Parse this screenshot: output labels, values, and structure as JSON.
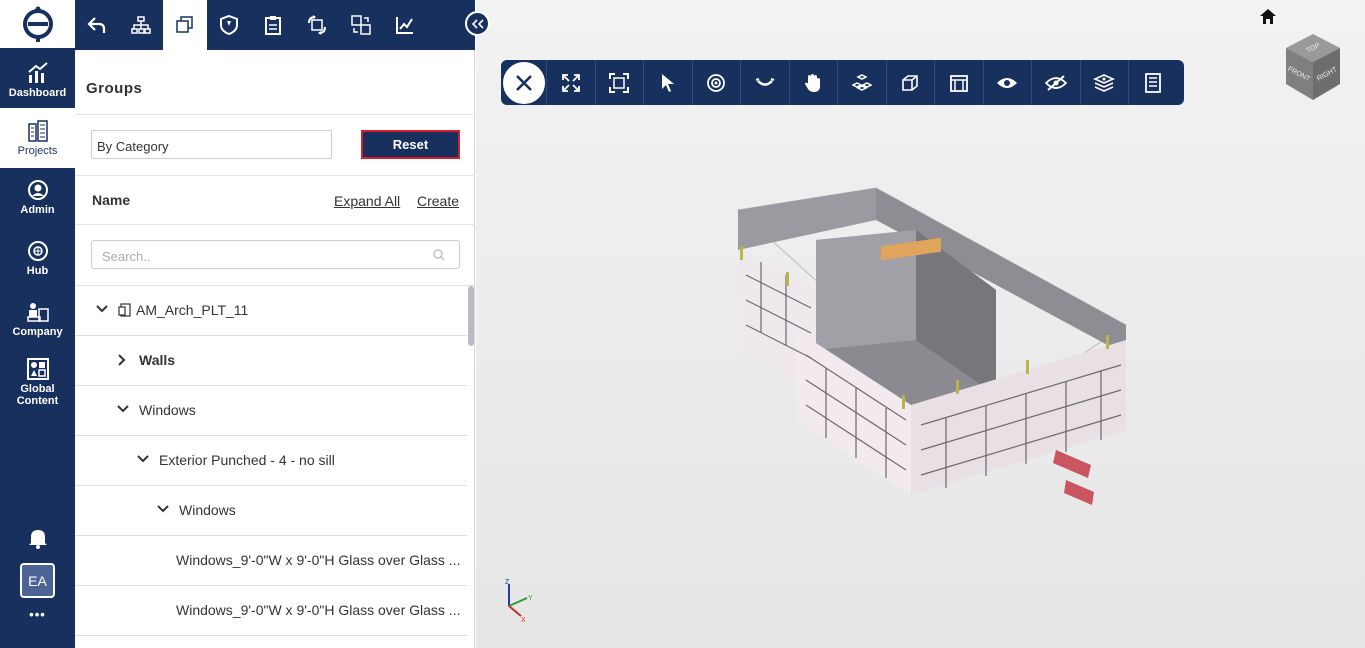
{
  "nav": {
    "items": [
      {
        "label": "Dashboard"
      },
      {
        "label": "Projects"
      },
      {
        "label": "Admin"
      },
      {
        "label": "Hub"
      },
      {
        "label": "Company"
      },
      {
        "label": "Global Content"
      }
    ],
    "avatar_initials": "EA",
    "more": "•••"
  },
  "panel": {
    "title": "Groups",
    "group_by_value": "By Category",
    "reset_label": "Reset",
    "name_header": "Name",
    "expand_all": "Expand All",
    "create": "Create",
    "search_placeholder": "Search..",
    "tree": [
      {
        "label": "AM_Arch_PLT_11"
      },
      {
        "label": "Walls"
      },
      {
        "label": "Windows"
      },
      {
        "label": "Exterior Punched - 4 - no sill"
      },
      {
        "label": "Windows"
      },
      {
        "label": "Windows_9'-0\"W x 9'-0\"H Glass over Glass ..."
      },
      {
        "label": "Windows_9'-0\"W x 9'-0\"H Glass over Glass ..."
      }
    ]
  },
  "viewer": {
    "viewcube_faces": {
      "top": "TOP",
      "front": "FRONT",
      "right": "RIGHT"
    },
    "axes": {
      "z": "Z",
      "y": "Y",
      "x": "X"
    }
  },
  "colors": {
    "navy": "#17305e",
    "accent_red": "#d61f2b"
  }
}
